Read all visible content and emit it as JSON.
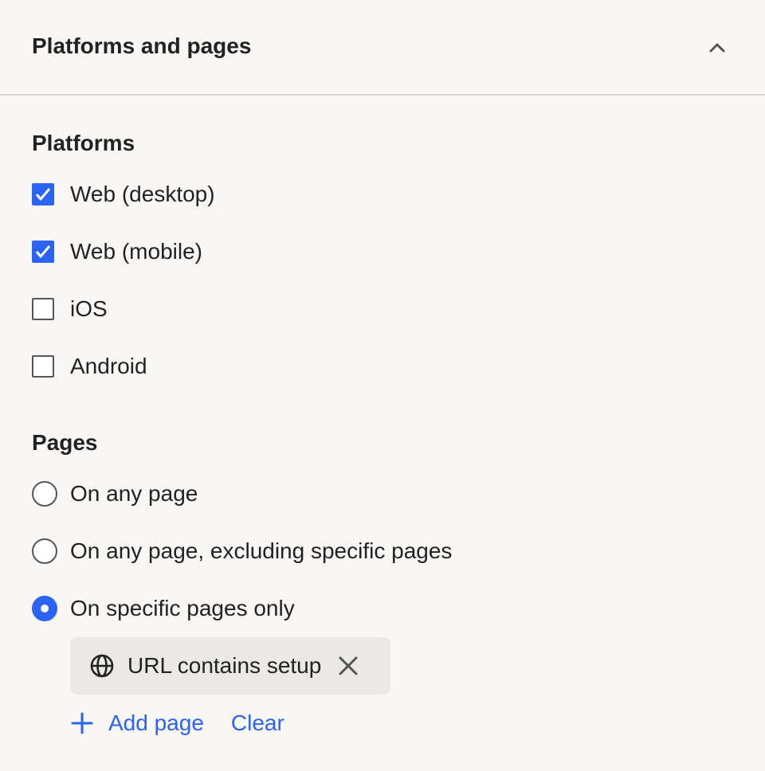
{
  "header": {
    "title": "Platforms and pages",
    "collapse_icon": "chevron-up-icon"
  },
  "platforms": {
    "title": "Platforms",
    "items": [
      {
        "label": "Web (desktop)",
        "checked": true
      },
      {
        "label": "Web (mobile)",
        "checked": true
      },
      {
        "label": "iOS",
        "checked": false
      },
      {
        "label": "Android",
        "checked": false
      }
    ]
  },
  "pages": {
    "title": "Pages",
    "options": [
      {
        "label": "On any page",
        "selected": false
      },
      {
        "label": "On any page, excluding specific pages",
        "selected": false
      },
      {
        "label": "On specific pages only",
        "selected": true
      }
    ],
    "rule_chip": {
      "icon": "globe-icon",
      "label": "URL contains setup",
      "remove_icon": "close-icon"
    },
    "add_page_label": "Add page",
    "clear_label": "Clear"
  },
  "colors": {
    "accent": "#2a63f6",
    "background": "#f8f7f5",
    "chip_background": "#ebe9e6",
    "text": "#222222"
  }
}
